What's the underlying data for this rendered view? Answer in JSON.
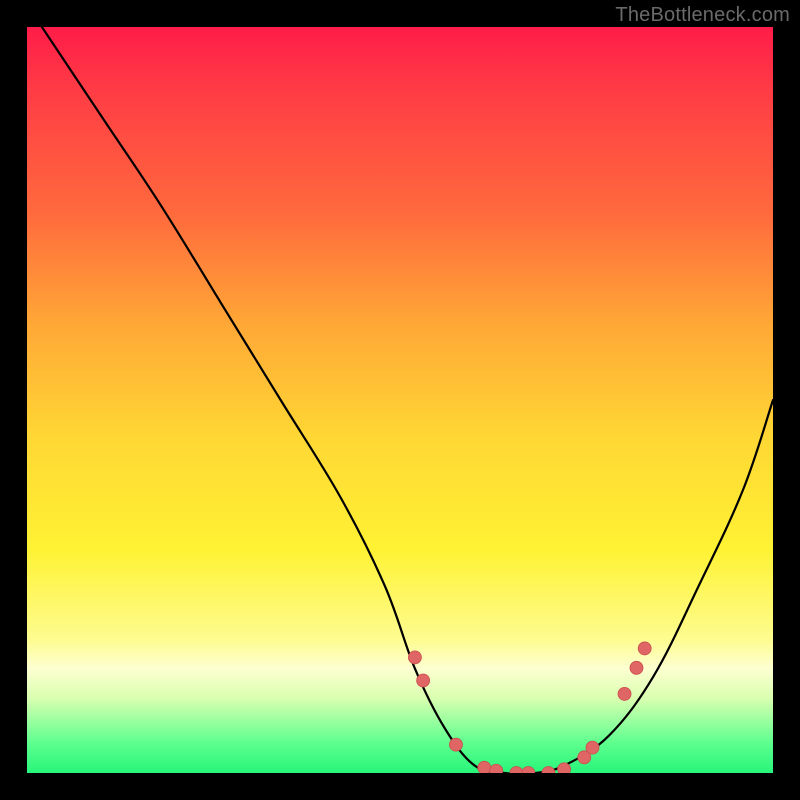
{
  "watermark": "TheBottleneck.com",
  "colors": {
    "frame": "#000000",
    "curve": "#000000",
    "marker_fill": "#e06666",
    "marker_stroke": "#c94f4f"
  },
  "chart_data": {
    "type": "line",
    "title": "",
    "xlabel": "",
    "ylabel": "",
    "xlim": [
      0,
      100
    ],
    "ylim": [
      0,
      100
    ],
    "note": "V-shaped bottleneck curve on red→green vertical gradient; no axis ticks or labels. Values are estimated from pixel positions since the chart has no numeric annotations.",
    "series": [
      {
        "name": "bottleneck-curve",
        "x": [
          2,
          10,
          18,
          26,
          34,
          42,
          48,
          52,
          56,
          60,
          64,
          68,
          72,
          78,
          84,
          90,
          96,
          100
        ],
        "y": [
          100,
          88,
          76,
          63,
          50,
          37,
          25,
          14,
          6,
          1,
          0,
          0,
          1,
          5,
          13,
          25,
          38,
          50
        ]
      }
    ],
    "markers": [
      {
        "x": 52.0,
        "y": 15.5
      },
      {
        "x": 53.1,
        "y": 12.4
      },
      {
        "x": 57.5,
        "y": 3.8
      },
      {
        "x": 61.3,
        "y": 0.7
      },
      {
        "x": 62.9,
        "y": 0.3
      },
      {
        "x": 65.6,
        "y": 0.0
      },
      {
        "x": 67.2,
        "y": 0.0
      },
      {
        "x": 69.9,
        "y": 0.0
      },
      {
        "x": 72.0,
        "y": 0.5
      },
      {
        "x": 74.7,
        "y": 2.1
      },
      {
        "x": 75.8,
        "y": 3.4
      },
      {
        "x": 80.1,
        "y": 10.6
      },
      {
        "x": 81.7,
        "y": 14.1
      },
      {
        "x": 82.8,
        "y": 16.7
      }
    ]
  }
}
